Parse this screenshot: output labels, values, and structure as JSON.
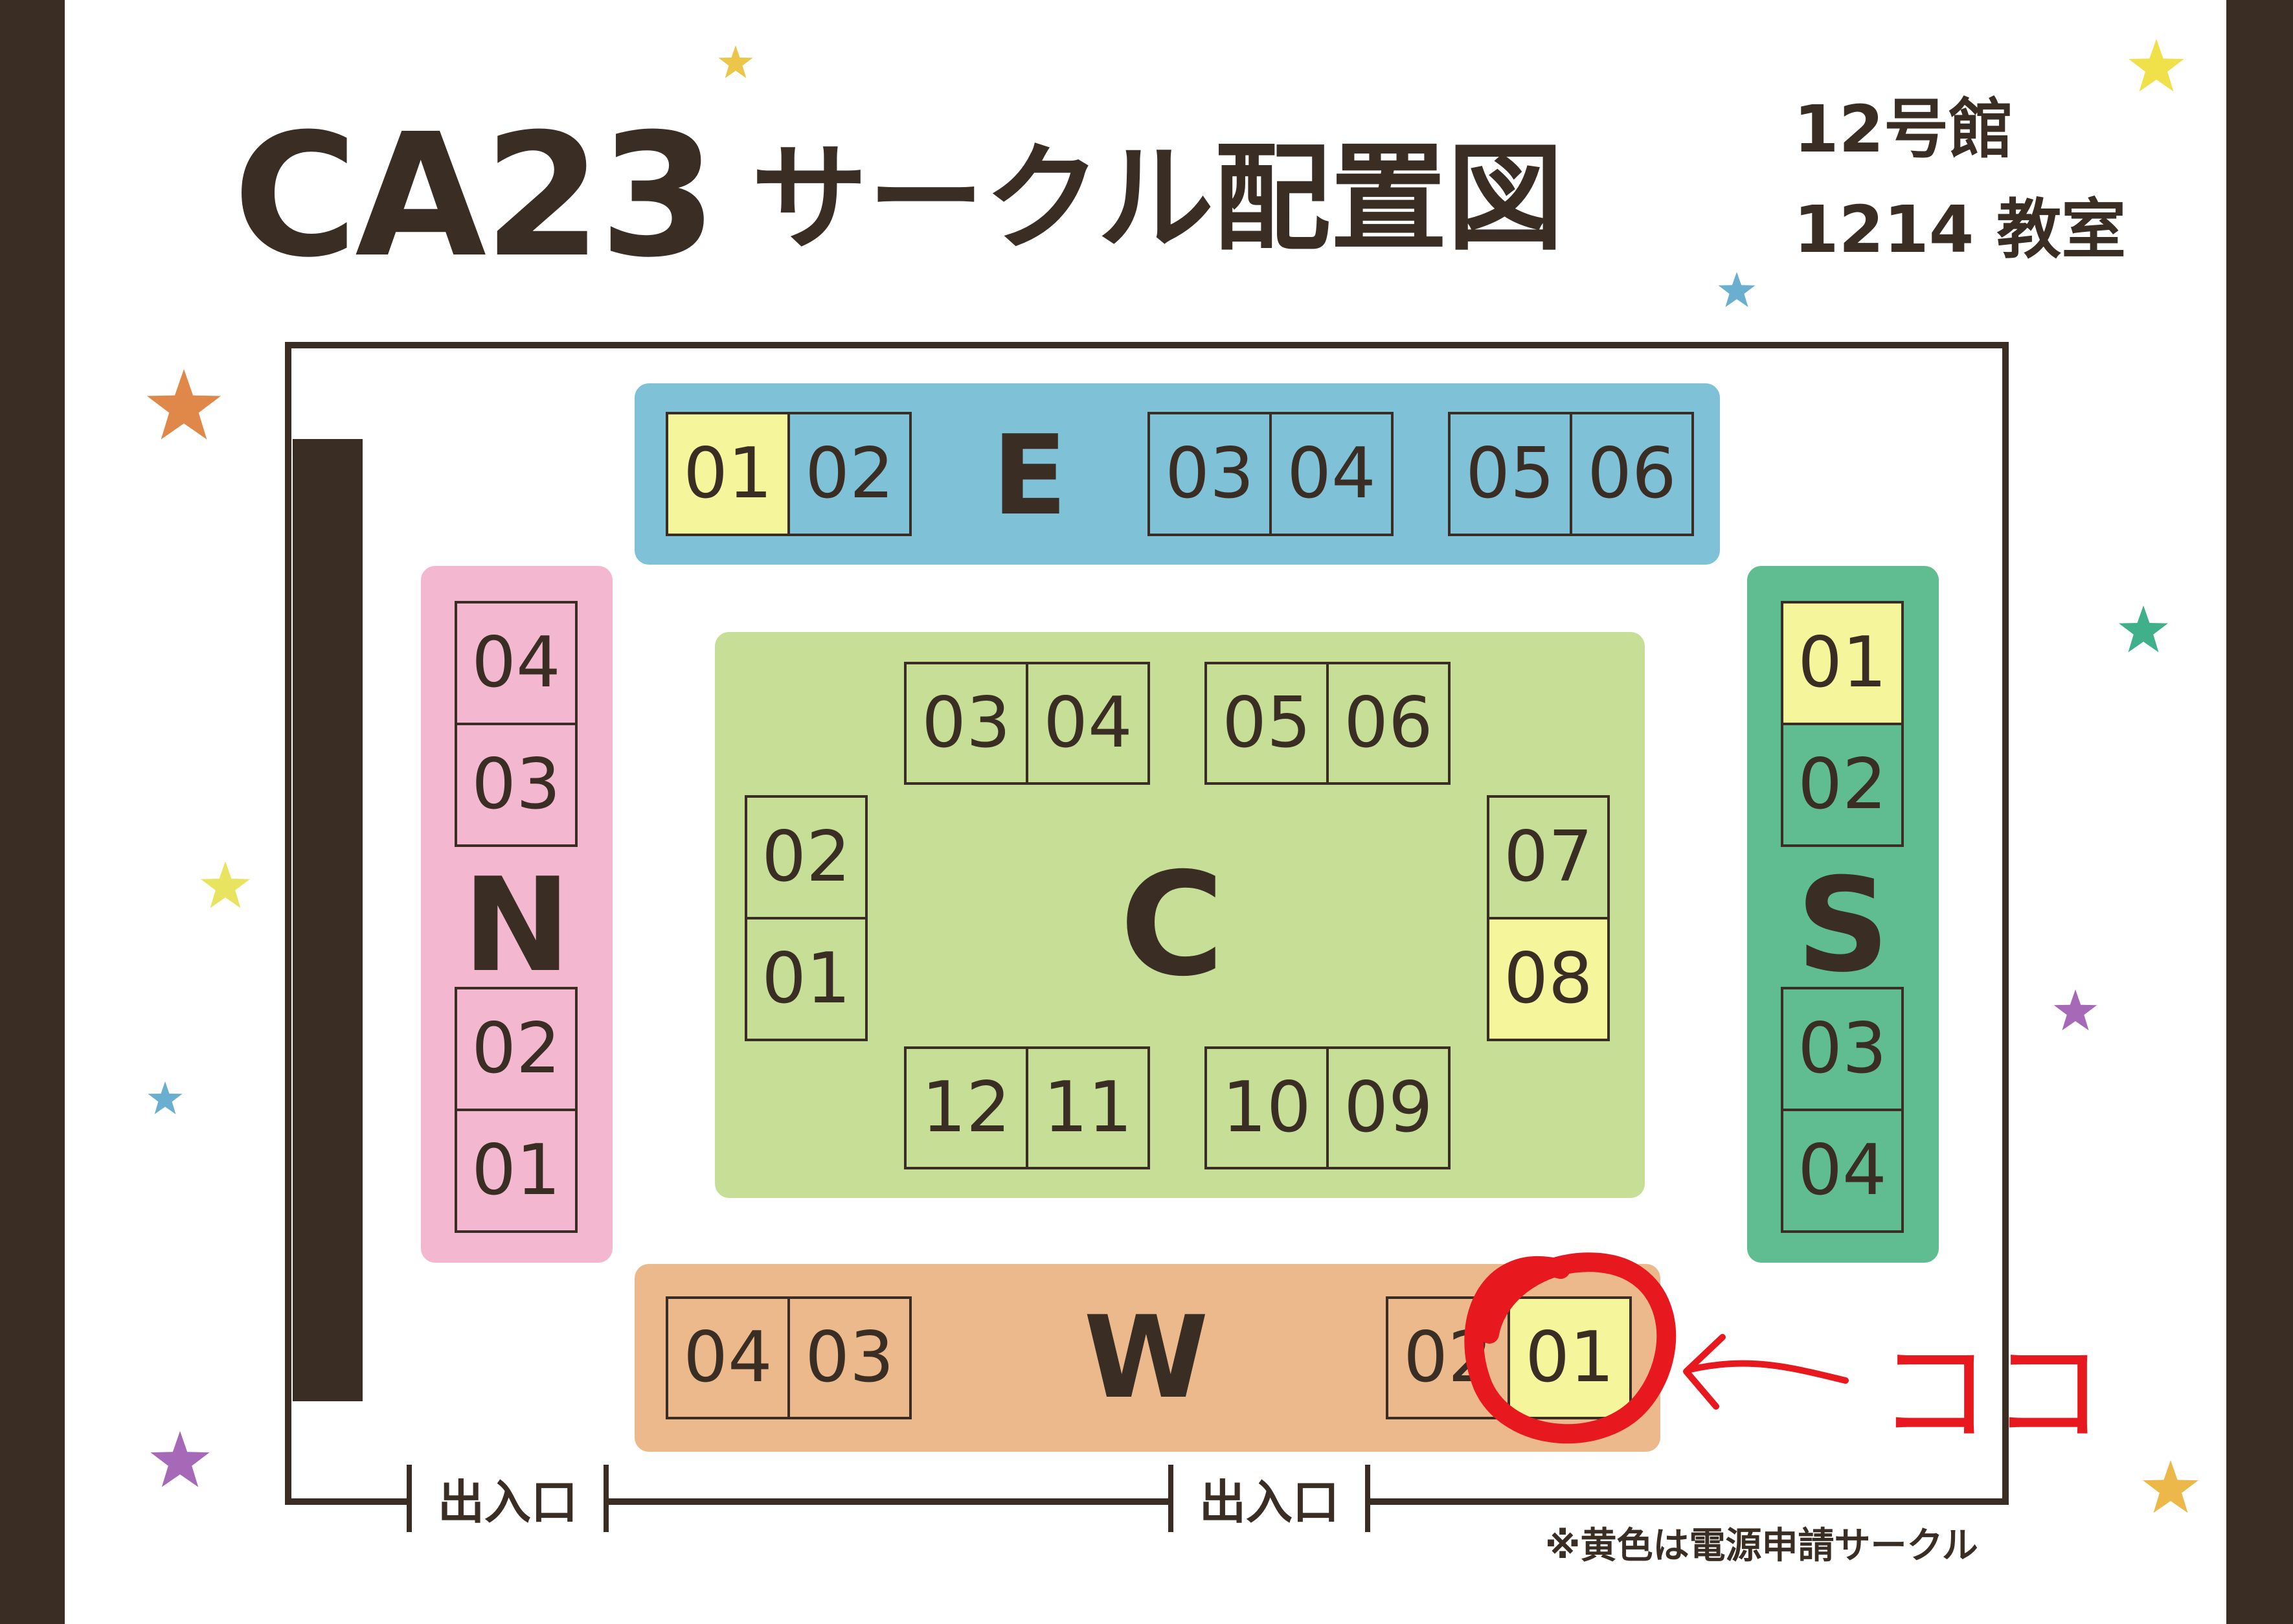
{
  "title": {
    "event": "CA23",
    "subtitle": "サークル配置図"
  },
  "location": {
    "building": "12号館",
    "room": "1214 教室"
  },
  "blocks": {
    "E": {
      "label": "E",
      "color": "#7fc2d8",
      "cells": [
        {
          "text": "01",
          "power": true
        },
        {
          "text": "02",
          "power": false
        },
        {
          "text": "03",
          "power": false
        },
        {
          "text": "04",
          "power": false
        },
        {
          "text": "05",
          "power": false
        },
        {
          "text": "06",
          "power": false
        }
      ]
    },
    "N": {
      "label": "N",
      "color": "#f3b8cf",
      "cells": [
        {
          "text": "04",
          "power": false
        },
        {
          "text": "03",
          "power": false
        },
        {
          "text": "02",
          "power": false
        },
        {
          "text": "01",
          "power": false
        }
      ]
    },
    "C": {
      "label": "C",
      "color": "#c7de97",
      "cells": [
        {
          "text": "03",
          "power": false
        },
        {
          "text": "04",
          "power": false
        },
        {
          "text": "05",
          "power": false
        },
        {
          "text": "06",
          "power": false
        },
        {
          "text": "02",
          "power": false
        },
        {
          "text": "01",
          "power": false
        },
        {
          "text": "07",
          "power": false
        },
        {
          "text": "08",
          "power": true
        },
        {
          "text": "12",
          "power": false
        },
        {
          "text": "11",
          "power": false
        },
        {
          "text": "10",
          "power": false
        },
        {
          "text": "09",
          "power": false
        }
      ]
    },
    "S": {
      "label": "S",
      "color": "#5fbd91",
      "cells": [
        {
          "text": "01",
          "power": true
        },
        {
          "text": "02",
          "power": false
        },
        {
          "text": "03",
          "power": false
        },
        {
          "text": "04",
          "power": false
        }
      ]
    },
    "W": {
      "label": "W",
      "color": "#ecb98c",
      "cells": [
        {
          "text": "04",
          "power": false
        },
        {
          "text": "03",
          "power": false
        },
        {
          "text": "02",
          "power": false
        },
        {
          "text": "01",
          "power": true
        }
      ]
    }
  },
  "entrances": [
    "出入口",
    "出入口"
  ],
  "annotation": {
    "text": "ココ",
    "color": "#e8191e"
  },
  "note": "※黄色は電源申請サークル",
  "colors": {
    "dark": "#3a2e24",
    "power": "#f5f59c"
  },
  "decorations": [
    "star-icon"
  ]
}
